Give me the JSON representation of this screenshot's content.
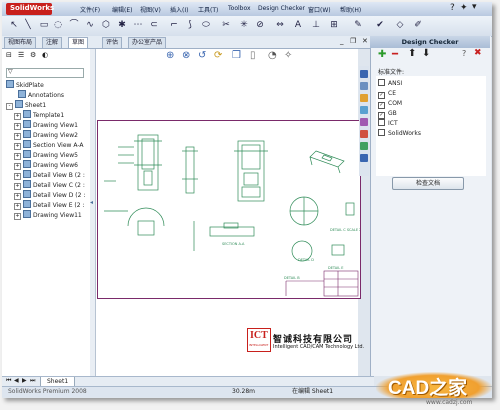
{
  "app": {
    "logo_text": "SolidWorks",
    "menu": [
      "文件(F)",
      "编辑(E)",
      "视图(V)",
      "插入(I)",
      "工具(T)",
      "Toolbox",
      "Design Checker",
      "窗口(W)",
      "帮助(H)"
    ]
  },
  "tabs": [
    "视图布局",
    "注解",
    "草图",
    "评估",
    "办公室产品"
  ],
  "active_tab_index": 2,
  "tree": {
    "root": "SkidPlate",
    "items": [
      {
        "label": "Annotations",
        "indent": 1,
        "expander": ""
      },
      {
        "label": "Sheet1",
        "indent": 0,
        "expander": "-"
      },
      {
        "label": "Template1",
        "indent": 1,
        "expander": "+"
      },
      {
        "label": "Drawing View1",
        "indent": 1,
        "expander": "+"
      },
      {
        "label": "Drawing View2",
        "indent": 1,
        "expander": "+"
      },
      {
        "label": "Section View A-A",
        "indent": 1,
        "expander": "+"
      },
      {
        "label": "Drawing View5",
        "indent": 1,
        "expander": "+"
      },
      {
        "label": "Drawing View6",
        "indent": 1,
        "expander": "+"
      },
      {
        "label": "Detail View B (2 :",
        "indent": 1,
        "expander": "+"
      },
      {
        "label": "Detail View C (2 :",
        "indent": 1,
        "expander": "+"
      },
      {
        "label": "Detail View D (2 :",
        "indent": 1,
        "expander": "+"
      },
      {
        "label": "Detail View E (2 :",
        "indent": 1,
        "expander": "+"
      },
      {
        "label": "Drawing View11",
        "indent": 1,
        "expander": "+"
      }
    ]
  },
  "drawing": {
    "labels": [
      "SECTION A-A",
      "DETAIL D",
      "DETAIL C\nSCALE 2:1",
      "DETAIL E",
      "DETAIL B"
    ]
  },
  "design_checker": {
    "title": "Design Checker",
    "standards_label": "标准文件:",
    "standards": [
      {
        "name": "ANSI",
        "checked": false
      },
      {
        "name": "CE",
        "checked": true
      },
      {
        "name": "COM",
        "checked": true
      },
      {
        "name": "GB",
        "checked": true
      },
      {
        "name": "ICT",
        "checked": false
      },
      {
        "name": "SolidWorks",
        "checked": false
      }
    ],
    "check_button": "检查文档"
  },
  "brand": {
    "logo": "ICT",
    "logo_sub": "INTELLIGENT",
    "name_cn": "智诚科技有限公司",
    "name_en": "Intelligent CAD/CAM Technology Ltd."
  },
  "sheet_tab": "Sheet1",
  "status": {
    "left": "SolidWorks Premium 2008",
    "coords": "30.28m",
    "state": "在编辑 Sheet1"
  },
  "watermark": {
    "text": "CAD之家",
    "url": "www.cadzj.com"
  },
  "colors": {
    "accent_blue": "#3a66b0",
    "drawing_green": "#2e8b57",
    "sheet_border": "#7a2a6a",
    "logo_red": "#c8201c",
    "watermark_orange": "#f0a030"
  }
}
